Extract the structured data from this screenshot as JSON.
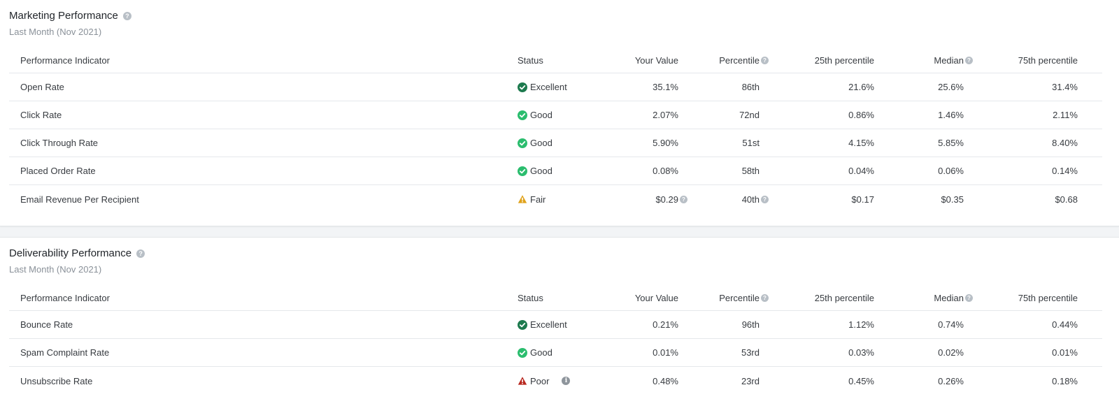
{
  "colors": {
    "excellent": "#1d7a4e",
    "good": "#2bbd6e",
    "fair": "#e0a21a",
    "poor": "#b8271f"
  },
  "columns": {
    "indicator": "Performance Indicator",
    "status": "Status",
    "your_value": "Your Value",
    "percentile": "Percentile",
    "p25": "25th percentile",
    "median": "Median",
    "p75": "75th percentile"
  },
  "marketing": {
    "title": "Marketing Performance",
    "subtitle": "Last Month (Nov 2021)",
    "rows": [
      {
        "name": "Open Rate",
        "status": "Excellent",
        "status_icon": "check-circle-dark-icon",
        "value": "35.1%",
        "percentile": "86th",
        "p25": "21.6%",
        "median": "25.6%",
        "p75": "31.4%"
      },
      {
        "name": "Click Rate",
        "status": "Good",
        "status_icon": "check-circle-icon",
        "value": "2.07%",
        "percentile": "72nd",
        "p25": "0.86%",
        "median": "1.46%",
        "p75": "2.11%"
      },
      {
        "name": "Click Through Rate",
        "status": "Good",
        "status_icon": "check-circle-icon",
        "value": "5.90%",
        "percentile": "51st",
        "p25": "4.15%",
        "median": "5.85%",
        "p75": "8.40%"
      },
      {
        "name": "Placed Order Rate",
        "status": "Good",
        "status_icon": "check-circle-icon",
        "value": "0.08%",
        "percentile": "58th",
        "p25": "0.04%",
        "median": "0.06%",
        "p75": "0.14%"
      },
      {
        "name": "Email Revenue Per Recipient",
        "status": "Fair",
        "status_icon": "warning-triangle-icon",
        "value": "$0.29",
        "percentile": "40th",
        "p25": "$0.17",
        "median": "$0.35",
        "p75": "$0.68"
      }
    ]
  },
  "deliverability": {
    "title": "Deliverability Performance",
    "subtitle": "Last Month (Nov 2021)",
    "rows": [
      {
        "name": "Bounce Rate",
        "status": "Excellent",
        "status_icon": "check-circle-dark-icon",
        "value": "0.21%",
        "percentile": "96th",
        "p25": "1.12%",
        "median": "0.74%",
        "p75": "0.44%"
      },
      {
        "name": "Spam Complaint Rate",
        "status": "Good",
        "status_icon": "check-circle-icon",
        "value": "0.01%",
        "percentile": "53rd",
        "p25": "0.03%",
        "median": "0.02%",
        "p75": "0.01%"
      },
      {
        "name": "Unsubscribe Rate",
        "status": "Poor",
        "status_icon": "warning-triangle-red-icon",
        "value": "0.48%",
        "percentile": "23rd",
        "p25": "0.45%",
        "median": "0.26%",
        "p75": "0.18%"
      }
    ]
  }
}
